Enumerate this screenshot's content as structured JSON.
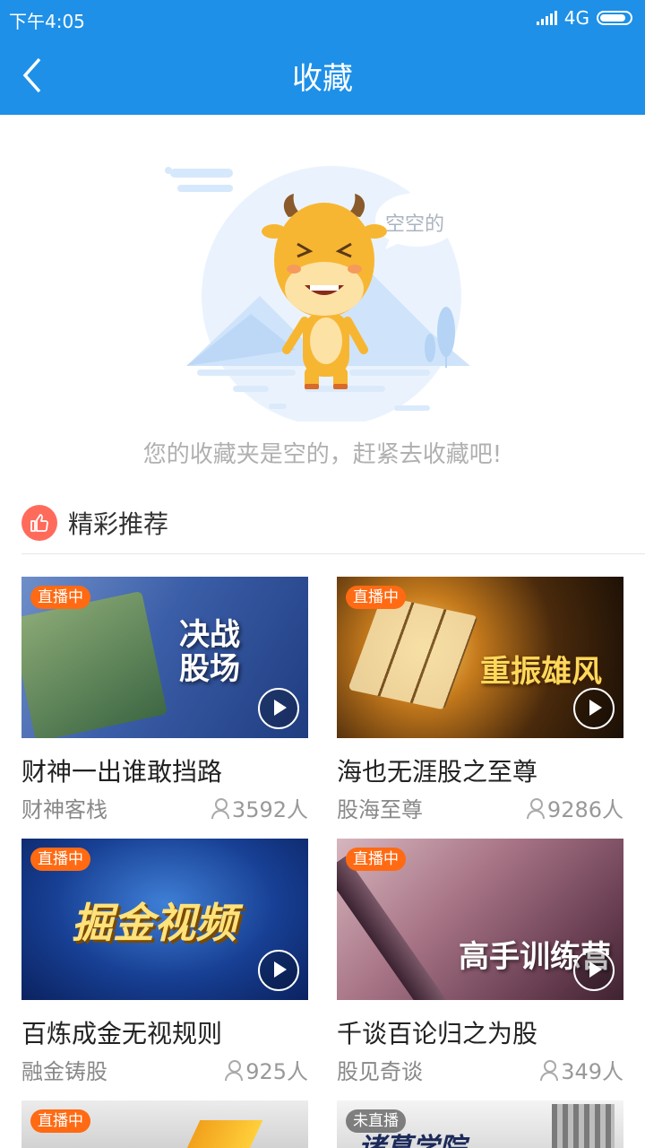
{
  "status_bar": {
    "time": "下午4:05",
    "network": "4G"
  },
  "header": {
    "title": "收藏",
    "back_icon": "chevron-left-icon"
  },
  "empty_state": {
    "bubble_text": "空空的",
    "message": "您的收藏夹是空的，赶紧去收藏吧!"
  },
  "recommend": {
    "title": "精彩推荐",
    "icon": "thumbs-up-icon",
    "items": [
      {
        "badge": "直播中",
        "thumb_text": "决战股场",
        "title": "财神一出谁敢挡路",
        "host": "财神客栈",
        "viewers": "3592人"
      },
      {
        "badge": "直播中",
        "thumb_text": "重振雄风",
        "title": "海也无涯股之至尊",
        "host": "股海至尊",
        "viewers": "9286人"
      },
      {
        "badge": "直播中",
        "thumb_text": "掘金视频",
        "title": "百炼成金无视规则",
        "host": "融金铸股",
        "viewers": "925人"
      },
      {
        "badge": "直播中",
        "thumb_text": "高手训练营",
        "title": "千谈百论归之为股",
        "host": "股见奇谈",
        "viewers": "349人"
      },
      {
        "badge": "直播中",
        "thumb_text": ""
      },
      {
        "badge": "未直播",
        "thumb_text": "诸葛学院"
      }
    ]
  },
  "colors": {
    "primary": "#1e90e8",
    "live_badge": "#ff6a13",
    "accent_red": "#ff6b5b"
  }
}
